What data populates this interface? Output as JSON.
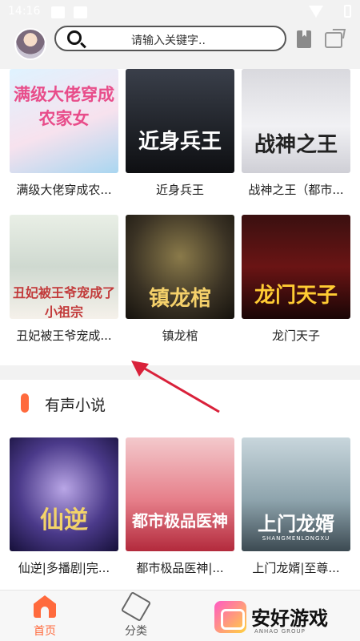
{
  "status_bar": {
    "time": "14:16"
  },
  "search": {
    "placeholder": "请输入关键字.."
  },
  "section1": {
    "books": [
      {
        "title": "满级大佬穿成农...",
        "cover_text": "满级大佬穿成农家女"
      },
      {
        "title": "近身兵王",
        "cover_text": "近身兵王"
      },
      {
        "title": "战神之王（都市...",
        "cover_text": "战神之王"
      },
      {
        "title": "丑妃被王爷宠成...",
        "cover_text": "丑妃被王爷宠成了小祖宗"
      },
      {
        "title": "镇龙棺",
        "cover_text": "镇龙棺"
      },
      {
        "title": "龙门天子",
        "cover_text": "龙门天子"
      }
    ]
  },
  "section2": {
    "title": "有声小说",
    "books": [
      {
        "title": "仙逆|多播剧|完...",
        "cover_text": "仙逆"
      },
      {
        "title": "都市极品医神|...",
        "cover_text": "都市极品医神"
      },
      {
        "title": "上门龙婿|至尊...",
        "cover_text": "上门龙婿",
        "cover_sub": "SHANGMENLONGXU"
      }
    ]
  },
  "tabbar": {
    "tabs": [
      {
        "label": "首页",
        "active": true
      },
      {
        "label": "分类",
        "active": false
      }
    ]
  },
  "watermark": {
    "text": "安好游戏",
    "sub": "ANHAO GROUP"
  },
  "colors": {
    "accent": "#ff6a3d",
    "annotation_arrow": "#d9213a"
  }
}
